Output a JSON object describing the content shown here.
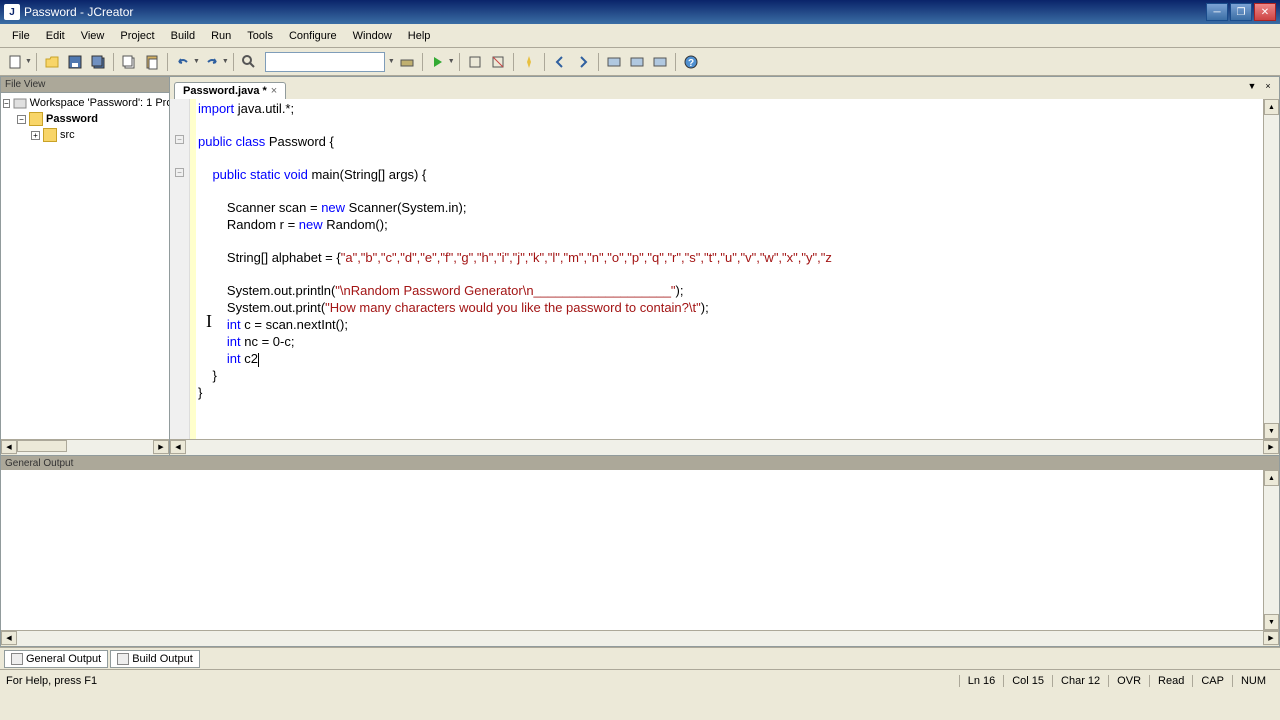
{
  "titlebar": {
    "text": "Password - JCreator"
  },
  "menu": {
    "file": "File",
    "edit": "Edit",
    "view": "View",
    "project": "Project",
    "build": "Build",
    "run": "Run",
    "tools": "Tools",
    "configure": "Configure",
    "window": "Window",
    "help": "Help"
  },
  "sidebar": {
    "title": "File View",
    "workspace": "Workspace 'Password': 1 Pro",
    "project": "Password",
    "src": "src"
  },
  "tab": {
    "name": "Password.java *"
  },
  "code": {
    "line1_a": "import",
    "line1_b": " java.util.*;",
    "line3_a": "public class",
    "line3_b": " Password {",
    "line5_a": "    ",
    "line5_b": "public static void",
    "line5_c": " main(String[] args) {",
    "line7_a": "        Scanner scan = ",
    "line7_b": "new",
    "line7_c": " Scanner(System.in);",
    "line8_a": "        Random r = ",
    "line8_b": "new",
    "line8_c": " Random();",
    "line10_a": "        String[] alphabet = {",
    "line10_b": "\"a\",\"b\",\"c\",\"d\",\"e\",\"f\",\"g\",\"h\",\"i\",\"j\",\"k\",\"l\",\"m\",\"n\",\"o\",\"p\",\"q\",\"r\",\"s\",\"t\",\"u\",\"v\",\"w\",\"x\",\"y\",\"z",
    "line12_a": "        System.out.println(",
    "line12_b": "\"\\nRandom Password Generator\\n___________________\"",
    "line12_c": ");",
    "line13_a": "        System.out.print(",
    "line13_b": "\"How many characters would you like the password to contain?\\t\"",
    "line13_c": ");",
    "line14_a": "        ",
    "line14_b": "int",
    "line14_c": " c = scan.nextInt();",
    "line15_a": "        ",
    "line15_b": "int",
    "line15_c": " nc = 0-c;",
    "line16_a": "        ",
    "line16_b": "int",
    "line16_c": " c2",
    "line17": "    }",
    "line18": "}"
  },
  "output": {
    "title": "General Output",
    "tab_general": "General Output",
    "tab_build": "Build Output"
  },
  "status": {
    "help": "For Help, press F1",
    "ln": "Ln 16",
    "col": "Col 15",
    "char": "Char 12",
    "ovr": "OVR",
    "read": "Read",
    "cap": "CAP",
    "num": "NUM"
  }
}
